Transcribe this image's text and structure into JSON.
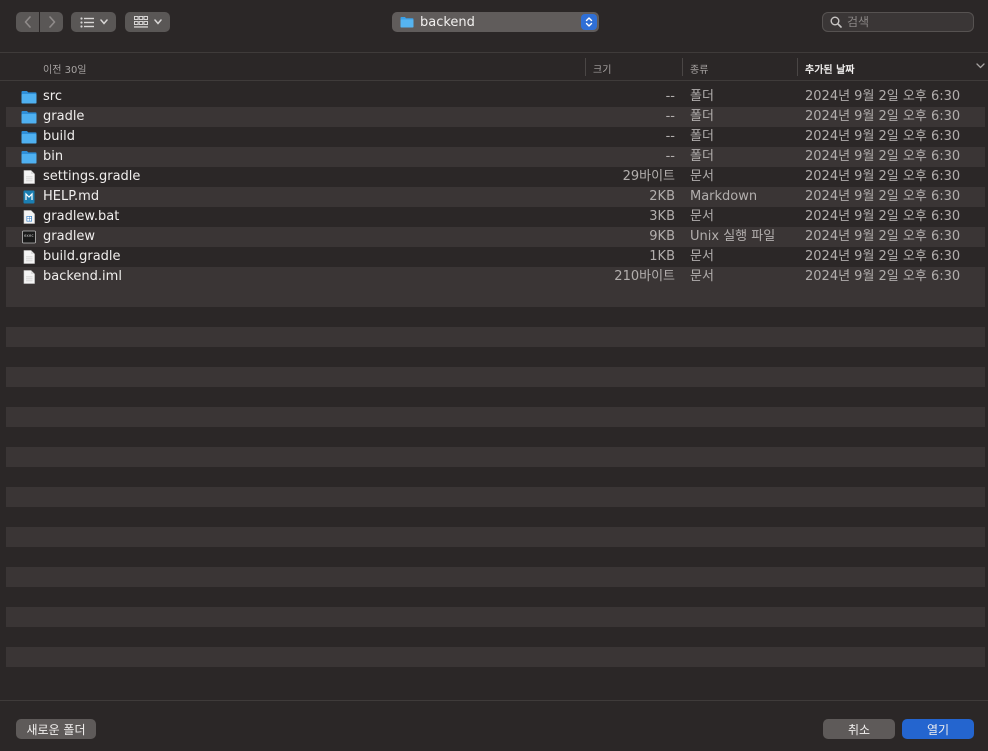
{
  "toolbar": {
    "location_label": "backend",
    "search_placeholder": "검색"
  },
  "columns": {
    "name": "이전 30일",
    "size": "크기",
    "kind": "종류",
    "date_added": "추가된 날짜"
  },
  "files": [
    {
      "name": "src",
      "size": "--",
      "kind": "폴더",
      "date": "2024년 9월 2일 오후 6:30",
      "icon": "folder-icon"
    },
    {
      "name": "gradle",
      "size": "--",
      "kind": "폴더",
      "date": "2024년 9월 2일 오후 6:30",
      "icon": "folder-icon"
    },
    {
      "name": "build",
      "size": "--",
      "kind": "폴더",
      "date": "2024년 9월 2일 오후 6:30",
      "icon": "folder-icon"
    },
    {
      "name": "bin",
      "size": "--",
      "kind": "폴더",
      "date": "2024년 9월 2일 오후 6:30",
      "icon": "folder-icon"
    },
    {
      "name": "settings.gradle",
      "size": "29바이트",
      "kind": "문서",
      "date": "2024년 9월 2일 오후 6:30",
      "icon": "document-icon"
    },
    {
      "name": "HELP.md",
      "size": "2KB",
      "kind": "Markdown",
      "date": "2024년 9월 2일 오후 6:30",
      "icon": "markdown-icon"
    },
    {
      "name": "gradlew.bat",
      "size": "3KB",
      "kind": "문서",
      "date": "2024년 9월 2일 오후 6:30",
      "icon": "bat-document-icon"
    },
    {
      "name": "gradlew",
      "size": "9KB",
      "kind": "Unix 실행 파일",
      "date": "2024년 9월 2일 오후 6:30",
      "icon": "terminal-executable-icon"
    },
    {
      "name": "build.gradle",
      "size": "1KB",
      "kind": "문서",
      "date": "2024년 9월 2일 오후 6:30",
      "icon": "document-icon"
    },
    {
      "name": "backend.iml",
      "size": "210바이트",
      "kind": "문서",
      "date": "2024년 9월 2일 오후 6:30",
      "icon": "document-icon"
    }
  ],
  "footer": {
    "new_folder": "새로운 폴더",
    "cancel": "취소",
    "open": "열기"
  },
  "colors": {
    "folder": "#3aa0e8",
    "accent": "#2465cf"
  }
}
